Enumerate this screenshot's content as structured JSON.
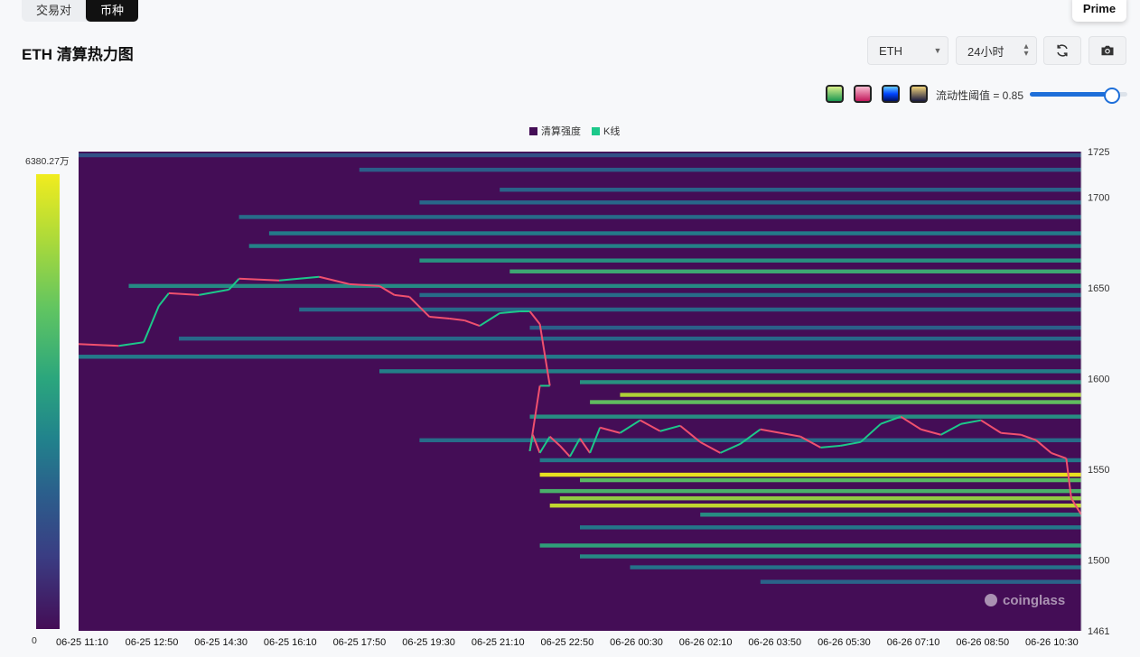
{
  "tabs": [
    "交易对",
    "币种"
  ],
  "prime_label": "Prime",
  "title": "ETH 清算热力图",
  "controls": {
    "coin": "ETH",
    "period": "24小时"
  },
  "icons": {
    "refresh": "refresh-icon",
    "camera": "camera-icon",
    "dropdown": "chevron-down-icon",
    "updown": "updown-arrow-icon"
  },
  "palettes": [
    {
      "name": "palette-green",
      "colors": [
        "#1a9850",
        "#d9ef8b"
      ]
    },
    {
      "name": "palette-pink",
      "colors": [
        "#c2185b",
        "#f8bbd0"
      ]
    },
    {
      "name": "palette-blue",
      "colors": [
        "#0044ff",
        "#66ccff"
      ]
    },
    {
      "name": "palette-gold",
      "colors": [
        "#1a1a40",
        "#f0d27a"
      ]
    }
  ],
  "threshold_label": "流动性阈值 = 0.85",
  "threshold_value": 0.85,
  "legend": [
    {
      "label": "清算强度",
      "color": "#440d56"
    },
    {
      "label": "K线",
      "color": "#1cc88a"
    }
  ],
  "colorbar": {
    "max_label": "6380.27万",
    "min_label": "0"
  },
  "watermark": "coinglass",
  "chart_data": {
    "type": "heatmap",
    "y_range": [
      1461,
      1725
    ],
    "y_ticks": [
      "1725",
      "1700",
      "1650",
      "1600",
      "1550",
      "1500",
      "1461"
    ],
    "x_ticks": [
      "06-25 11:10",
      "06-25 12:50",
      "06-25 14:30",
      "06-25 16:10",
      "06-25 17:50",
      "06-25 19:30",
      "06-25 21:10",
      "06-25 22:50",
      "06-26 00:30",
      "06-26 02:10",
      "06-26 03:50",
      "06-26 05:30",
      "06-26 07:10",
      "06-26 08:50",
      "06-26 10:30"
    ],
    "price_path": [
      [
        0,
        1619
      ],
      [
        0.04,
        1618
      ],
      [
        0.065,
        1620
      ],
      [
        0.08,
        1640
      ],
      [
        0.09,
        1647
      ],
      [
        0.12,
        1646
      ],
      [
        0.15,
        1649
      ],
      [
        0.16,
        1655
      ],
      [
        0.2,
        1654
      ],
      [
        0.24,
        1656
      ],
      [
        0.27,
        1652
      ],
      [
        0.3,
        1651
      ],
      [
        0.315,
        1646
      ],
      [
        0.33,
        1645
      ],
      [
        0.35,
        1634
      ],
      [
        0.37,
        1633
      ],
      [
        0.385,
        1632
      ],
      [
        0.4,
        1629
      ],
      [
        0.42,
        1636
      ],
      [
        0.44,
        1637
      ],
      [
        0.45,
        1637
      ],
      [
        0.46,
        1630
      ],
      [
        0.47,
        1596
      ],
      [
        0.46,
        1596
      ],
      [
        0.45,
        1560
      ],
      [
        0.453,
        1569
      ],
      [
        0.46,
        1559
      ],
      [
        0.47,
        1568
      ],
      [
        0.48,
        1563
      ],
      [
        0.49,
        1557
      ],
      [
        0.5,
        1567
      ],
      [
        0.51,
        1559
      ],
      [
        0.52,
        1573
      ],
      [
        0.54,
        1570
      ],
      [
        0.56,
        1577
      ],
      [
        0.58,
        1571
      ],
      [
        0.6,
        1574
      ],
      [
        0.62,
        1565
      ],
      [
        0.64,
        1559
      ],
      [
        0.66,
        1564
      ],
      [
        0.68,
        1572
      ],
      [
        0.7,
        1570
      ],
      [
        0.72,
        1568
      ],
      [
        0.74,
        1562
      ],
      [
        0.76,
        1563
      ],
      [
        0.78,
        1565
      ],
      [
        0.8,
        1575
      ],
      [
        0.82,
        1579
      ],
      [
        0.84,
        1572
      ],
      [
        0.86,
        1569
      ],
      [
        0.88,
        1575
      ],
      [
        0.9,
        1577
      ],
      [
        0.92,
        1570
      ],
      [
        0.94,
        1569
      ],
      [
        0.955,
        1566
      ],
      [
        0.97,
        1559
      ],
      [
        0.985,
        1556
      ],
      [
        0.99,
        1534
      ],
      [
        1.0,
        1525
      ]
    ],
    "liquidity_bands": [
      {
        "y": 1723,
        "x0": 0.0,
        "intensity": 0.24
      },
      {
        "y": 1715,
        "x0": 0.28,
        "intensity": 0.3
      },
      {
        "y": 1704,
        "x0": 0.42,
        "intensity": 0.32
      },
      {
        "y": 1697,
        "x0": 0.34,
        "intensity": 0.34
      },
      {
        "y": 1689,
        "x0": 0.16,
        "intensity": 0.36
      },
      {
        "y": 1680,
        "x0": 0.19,
        "intensity": 0.42
      },
      {
        "y": 1673,
        "x0": 0.17,
        "intensity": 0.45
      },
      {
        "y": 1665,
        "x0": 0.34,
        "intensity": 0.52
      },
      {
        "y": 1659,
        "x0": 0.43,
        "intensity": 0.62
      },
      {
        "y": 1651,
        "x0": 0.05,
        "intensity": 0.48
      },
      {
        "y": 1646,
        "x0": 0.34,
        "intensity": 0.36
      },
      {
        "y": 1638,
        "x0": 0.22,
        "intensity": 0.35
      },
      {
        "y": 1628,
        "x0": 0.45,
        "intensity": 0.3
      },
      {
        "y": 1622,
        "x0": 0.1,
        "intensity": 0.34
      },
      {
        "y": 1612,
        "x0": 0.0,
        "intensity": 0.42
      },
      {
        "y": 1604,
        "x0": 0.3,
        "intensity": 0.44
      },
      {
        "y": 1598,
        "x0": 0.5,
        "intensity": 0.52
      },
      {
        "y": 1591,
        "x0": 0.54,
        "intensity": 0.88
      },
      {
        "y": 1587,
        "x0": 0.51,
        "intensity": 0.72
      },
      {
        "y": 1579,
        "x0": 0.45,
        "intensity": 0.5
      },
      {
        "y": 1566,
        "x0": 0.34,
        "intensity": 0.36
      },
      {
        "y": 1555,
        "x0": 0.46,
        "intensity": 0.4
      },
      {
        "y": 1547,
        "x0": 0.46,
        "intensity": 1.0
      },
      {
        "y": 1544,
        "x0": 0.5,
        "intensity": 0.7
      },
      {
        "y": 1538,
        "x0": 0.46,
        "intensity": 0.66
      },
      {
        "y": 1534,
        "x0": 0.48,
        "intensity": 0.82
      },
      {
        "y": 1530,
        "x0": 0.47,
        "intensity": 0.92
      },
      {
        "y": 1525,
        "x0": 0.62,
        "intensity": 0.5
      },
      {
        "y": 1518,
        "x0": 0.5,
        "intensity": 0.4
      },
      {
        "y": 1508,
        "x0": 0.46,
        "intensity": 0.58
      },
      {
        "y": 1502,
        "x0": 0.5,
        "intensity": 0.48
      },
      {
        "y": 1496,
        "x0": 0.55,
        "intensity": 0.38
      },
      {
        "y": 1488,
        "x0": 0.68,
        "intensity": 0.32
      }
    ]
  }
}
